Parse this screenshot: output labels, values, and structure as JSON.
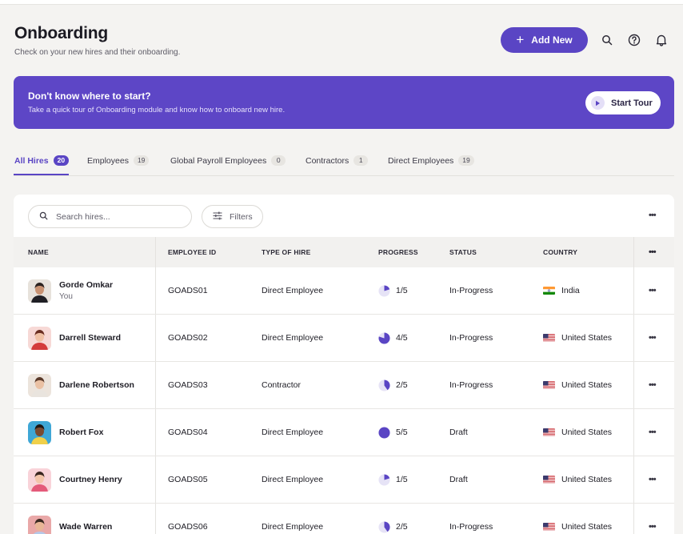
{
  "header": {
    "title": "Onboarding",
    "subtitle": "Check on your new hires and their onboarding.",
    "add_label": "Add New",
    "icons": [
      "search-icon",
      "help-icon",
      "bell-icon"
    ]
  },
  "banner": {
    "title": "Don't know where to start?",
    "subtitle": "Take a quick tour of Onboarding module and know how to onboard new hire.",
    "button_label": "Start Tour"
  },
  "tabs": [
    {
      "label": "All Hires",
      "count": "20",
      "active": true
    },
    {
      "label": "Employees",
      "count": "19",
      "active": false
    },
    {
      "label": "Global Payroll Employees",
      "count": "0",
      "active": false
    },
    {
      "label": "Contractors",
      "count": "1",
      "active": false
    },
    {
      "label": "Direct Employees",
      "count": "19",
      "active": false
    }
  ],
  "toolbar": {
    "search_placeholder": "Search hires...",
    "filters_label": "Filters",
    "more": "•••"
  },
  "table": {
    "columns": [
      "NAME",
      "EMPLOYEE ID",
      "TYPE OF HIRE",
      "PROGRESS",
      "STATUS",
      "COUNTRY"
    ],
    "more": "•••",
    "rows": [
      {
        "name": "Gorde Omkar",
        "sub": "You",
        "id": "GOADS01",
        "type": "Direct Employee",
        "progress": "1/5",
        "progress_value": 0.2,
        "status": "In-Progress",
        "country": "India",
        "flag": "india",
        "more": "•••"
      },
      {
        "name": "Darrell Steward",
        "sub": "",
        "id": "GOADS02",
        "type": "Direct Employee",
        "progress": "4/5",
        "progress_value": 0.8,
        "status": "In-Progress",
        "country": "United States",
        "flag": "us",
        "more": "•••"
      },
      {
        "name": "Darlene Robertson",
        "sub": "",
        "id": "GOADS03",
        "type": "Contractor",
        "progress": "2/5",
        "progress_value": 0.4,
        "status": "In-Progress",
        "country": "United States",
        "flag": "us",
        "more": "•••"
      },
      {
        "name": "Robert Fox",
        "sub": "",
        "id": "GOADS04",
        "type": "Direct Employee",
        "progress": "5/5",
        "progress_value": 1.0,
        "status": "Draft",
        "country": "United States",
        "flag": "us",
        "more": "•••"
      },
      {
        "name": "Courtney Henry",
        "sub": "",
        "id": "GOADS05",
        "type": "Direct Employee",
        "progress": "1/5",
        "progress_value": 0.2,
        "status": "Draft",
        "country": "United States",
        "flag": "us",
        "more": "•••"
      },
      {
        "name": "Wade Warren",
        "sub": "",
        "id": "GOADS06",
        "type": "Direct Employee",
        "progress": "2/5",
        "progress_value": 0.4,
        "status": "In-Progress",
        "country": "United States",
        "flag": "us",
        "more": "•••"
      }
    ]
  },
  "colors": {
    "accent": "#5a45c4",
    "banner": "#5d46c6",
    "progress_track": "#e6e3f6"
  }
}
